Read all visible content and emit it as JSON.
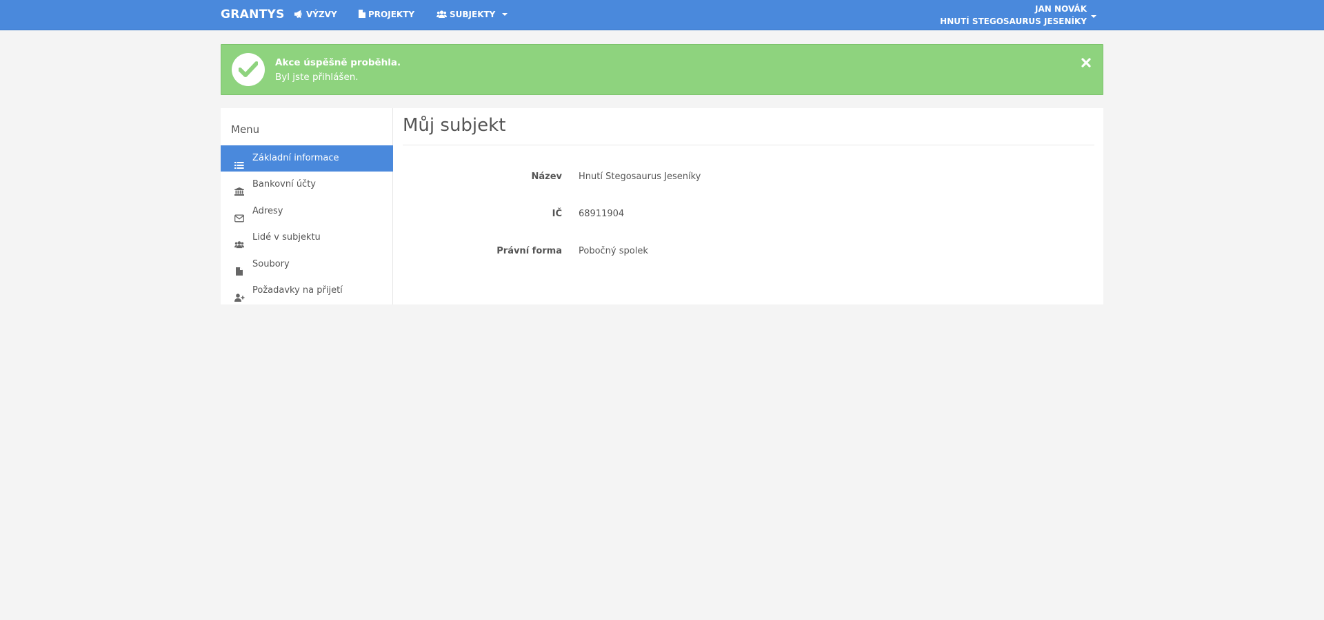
{
  "navbar": {
    "brand": "GRANTYS",
    "links": [
      {
        "label": "VÝZVY",
        "icon": "bullhorn-icon"
      },
      {
        "label": "PROJEKTY",
        "icon": "file-icon"
      },
      {
        "label": "SUBJEKTY",
        "icon": "users-icon"
      }
    ],
    "user": {
      "name": "JAN NOVÁK",
      "organization": "HNUTÍ STEGOSAURUS JESENÍKY"
    }
  },
  "alert": {
    "title": "Akce úspěšně proběhla.",
    "message": "Byl jste přihlášen.",
    "icon": "check-icon",
    "close_icon": "close-icon"
  },
  "sidebar": {
    "title": "Menu",
    "items": [
      {
        "label": "Základní informace",
        "icon": "list-icon",
        "active": true
      },
      {
        "label": "Bankovní účty",
        "icon": "bank-icon",
        "active": false
      },
      {
        "label": "Adresy",
        "icon": "envelope-icon",
        "active": false
      },
      {
        "label": "Lidé v subjektu",
        "icon": "users-icon",
        "active": false
      },
      {
        "label": "Soubory",
        "icon": "file-icon",
        "active": false
      },
      {
        "label": "Požadavky na přijetí",
        "icon": "user-plus-icon",
        "active": false
      }
    ]
  },
  "main": {
    "title": "Můj subjekt",
    "fields": [
      {
        "label": "Název",
        "value": "Hnutí Stegosaurus Jeseníky"
      },
      {
        "label": "IČ",
        "value": "68911904"
      },
      {
        "label": "Právní forma",
        "value": "Pobočný spolek"
      }
    ]
  },
  "colors": {
    "primary": "#4a89dc",
    "success": "#8ed37e",
    "background": "#f4f4f4"
  }
}
